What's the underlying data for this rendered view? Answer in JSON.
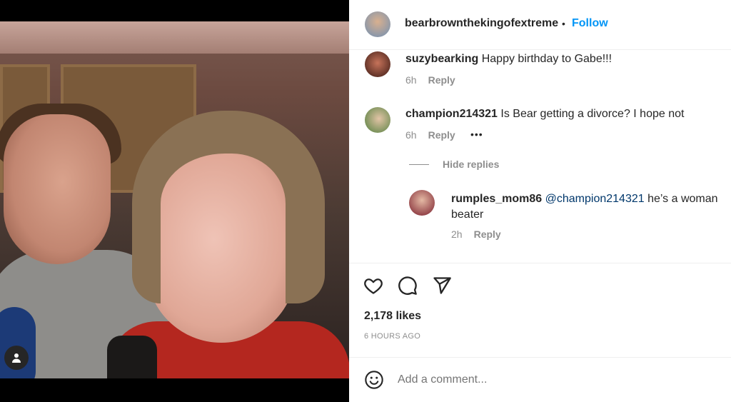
{
  "header": {
    "username": "bearbrownthekingofextreme",
    "separator": "•",
    "follow_label": "Follow"
  },
  "comments": [
    {
      "username": "suzybearking",
      "text": "Happy birthday to Gabe!!!",
      "time": "6h",
      "reply_label": "Reply"
    },
    {
      "username": "champion214321",
      "text": "Is Bear getting a divorce? I hope not",
      "time": "6h",
      "reply_label": "Reply",
      "more": "•••"
    }
  ],
  "hide_replies_label": "Hide replies",
  "reply": {
    "username": "rumples_mom86",
    "mention": "@champion214321",
    "text_line1": " he’s a woman",
    "text_line2": "beater",
    "time": "2h",
    "reply_label": "Reply"
  },
  "actions": {
    "like": "heart-icon",
    "comment": "comment-icon",
    "share": "send-icon"
  },
  "likes": "2,178 likes",
  "timestamp": "6 HOURS AGO",
  "add_comment": {
    "placeholder": "Add a comment..."
  },
  "colors": {
    "follow": "#0095f6",
    "mention": "#00376b",
    "muted": "#8e8e8e",
    "text": "#262626"
  }
}
